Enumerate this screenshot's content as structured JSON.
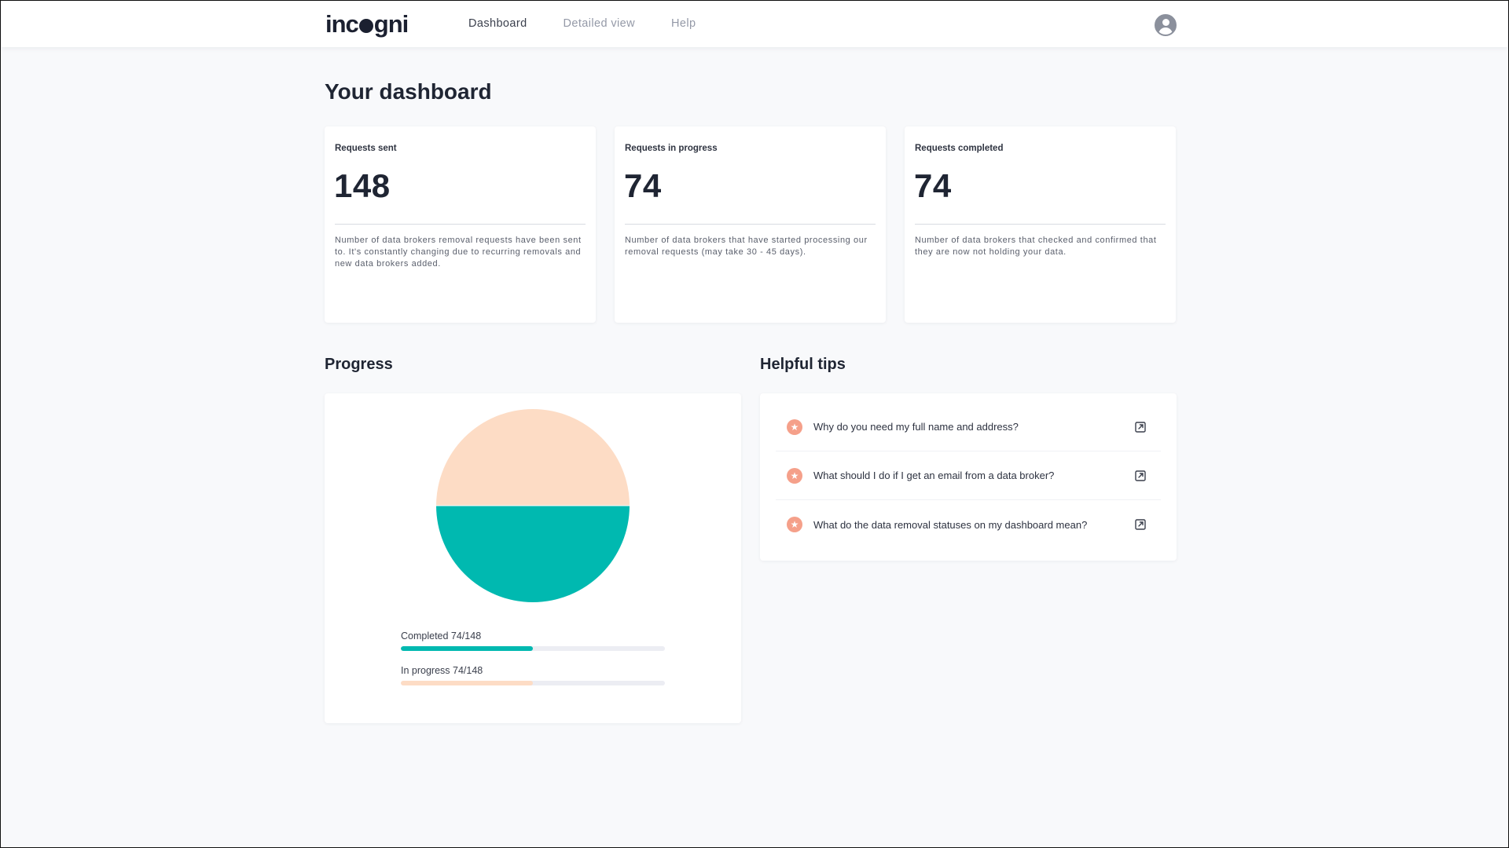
{
  "header": {
    "logo_text": "incogni",
    "nav": [
      {
        "label": "Dashboard",
        "active": true
      },
      {
        "label": "Detailed view",
        "active": false
      },
      {
        "label": "Help",
        "active": false
      }
    ],
    "avatar_icon": "user-avatar-icon"
  },
  "page": {
    "title": "Your dashboard"
  },
  "stats": [
    {
      "label": "Requests sent",
      "value": "148",
      "description": "Number of data brokers removal requests have been sent to. It's constantly changing due to recurring removals and new data brokers added."
    },
    {
      "label": "Requests in progress",
      "value": "74",
      "description": "Number of data brokers that have started processing our removal requests (may take 30 - 45 days)."
    },
    {
      "label": "Requests completed",
      "value": "74",
      "description": "Number of data brokers that checked and confirmed that they are now not holding your data."
    }
  ],
  "progress": {
    "title": "Progress",
    "completed_label": "Completed 74/148",
    "in_progress_label": "In progress 74/148",
    "colors": {
      "completed": "#00b9b0",
      "in_progress": "#fddcc5",
      "track": "#ecedf3"
    }
  },
  "chart_data": {
    "type": "pie",
    "categories": [
      "Completed",
      "In progress"
    ],
    "values": [
      74,
      74
    ],
    "total": 148,
    "colors": [
      "#00b9b0",
      "#fddcc5"
    ],
    "title": ""
  },
  "tips": {
    "title": "Helpful tips",
    "items": [
      {
        "text": "Why do you need my full name and address?",
        "icon": "star-icon",
        "action_icon": "external-link-icon"
      },
      {
        "text": "What should I do if I get an email from a data broker?",
        "icon": "star-icon",
        "action_icon": "external-link-icon"
      },
      {
        "text": "What do the data removal statuses on my dashboard mean?",
        "icon": "star-icon",
        "action_icon": "external-link-icon"
      }
    ]
  }
}
